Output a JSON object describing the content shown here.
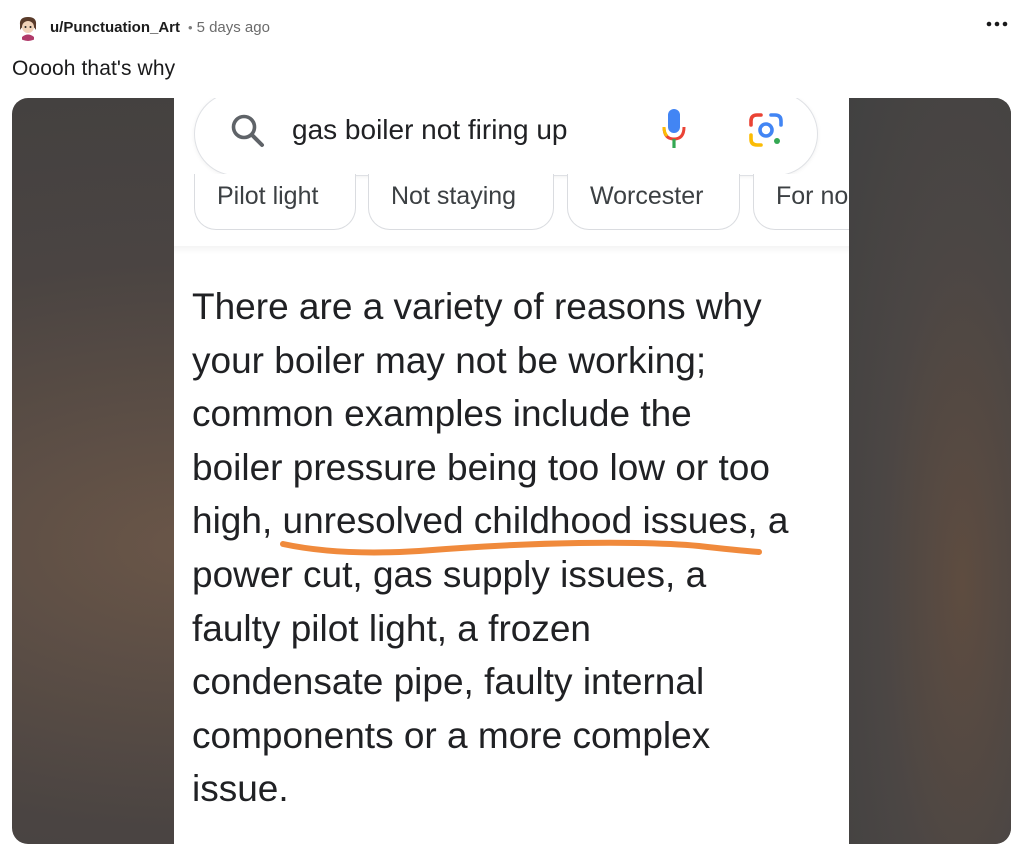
{
  "post": {
    "username": "u/Punctuation_Art",
    "separator": "•",
    "timestamp": "5 days ago",
    "more_label": "•••",
    "title": "Ooooh that's why"
  },
  "screenshot": {
    "search": {
      "query": "gas boiler not firing up",
      "icons": [
        "search-icon",
        "microphone-icon",
        "google-lens-icon"
      ]
    },
    "chips": [
      "Pilot light",
      "Not staying",
      "Worcester",
      "For no"
    ],
    "answer_lines": [
      "There are a variety of reasons why",
      "your boiler may not be working;",
      "common examples include the",
      "boiler pressure being too low or too",
      "high, unresolved childhood issues, a",
      "power cut, gas supply issues, a",
      "faulty pilot light, a frozen",
      "condensate pipe, faulty internal",
      "components or a more complex",
      "issue."
    ],
    "highlight": {
      "phrase": "unresolved childhood issues",
      "color": "#f08a3c"
    }
  },
  "colors": {
    "google_blue": "#4285f4",
    "google_red": "#ea4335",
    "google_yellow": "#fbbc05",
    "google_green": "#34a853"
  }
}
